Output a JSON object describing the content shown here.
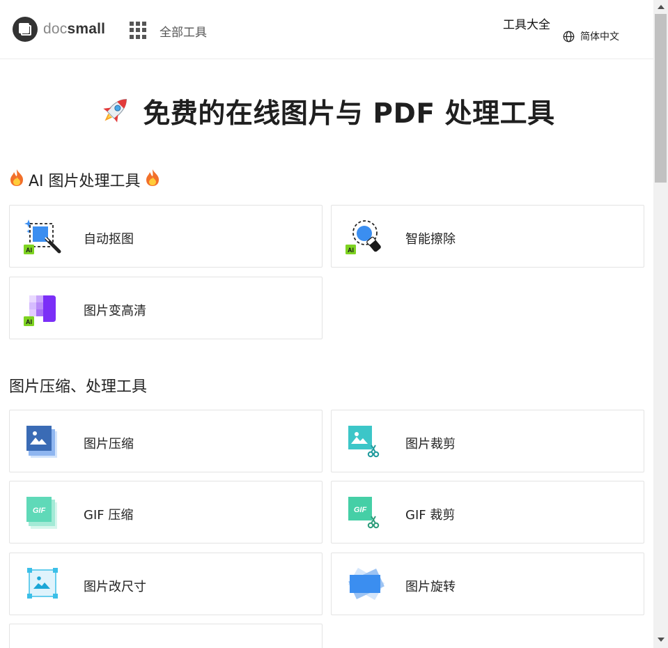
{
  "header": {
    "logo_doc": "doc",
    "logo_small": "small",
    "all_tools": "全部工具",
    "tools_title": "工具大全",
    "language": "简体中文"
  },
  "hero": {
    "title": "免费的在线图片与 PDF 处理工具"
  },
  "sections": {
    "ai": {
      "title": "AI 图片处理工具",
      "cards": [
        {
          "label": "自动抠图",
          "icon": "auto-cutout-icon"
        },
        {
          "label": "智能擦除",
          "icon": "smart-erase-icon"
        },
        {
          "label": "图片变高清",
          "icon": "image-enhance-icon"
        }
      ]
    },
    "image": {
      "title": "图片压缩、处理工具",
      "cards": [
        {
          "label": "图片压缩",
          "icon": "image-compress-icon"
        },
        {
          "label": "图片裁剪",
          "icon": "image-crop-icon"
        },
        {
          "label": "GIF 压缩",
          "icon": "gif-compress-icon"
        },
        {
          "label": "GIF 裁剪",
          "icon": "gif-crop-icon"
        },
        {
          "label": "图片改尺寸",
          "icon": "image-resize-icon"
        },
        {
          "label": "图片旋转",
          "icon": "image-rotate-icon"
        }
      ]
    }
  },
  "icon_labels": {
    "ai_badge": "AI",
    "gif_badge": "GIF"
  },
  "colors": {
    "ai_badge": "#7ed321",
    "blue": "#3b8ef0",
    "purple": "#7b2ff7",
    "teal": "#3cc6c8",
    "gif_green": "#5fd9b8"
  }
}
